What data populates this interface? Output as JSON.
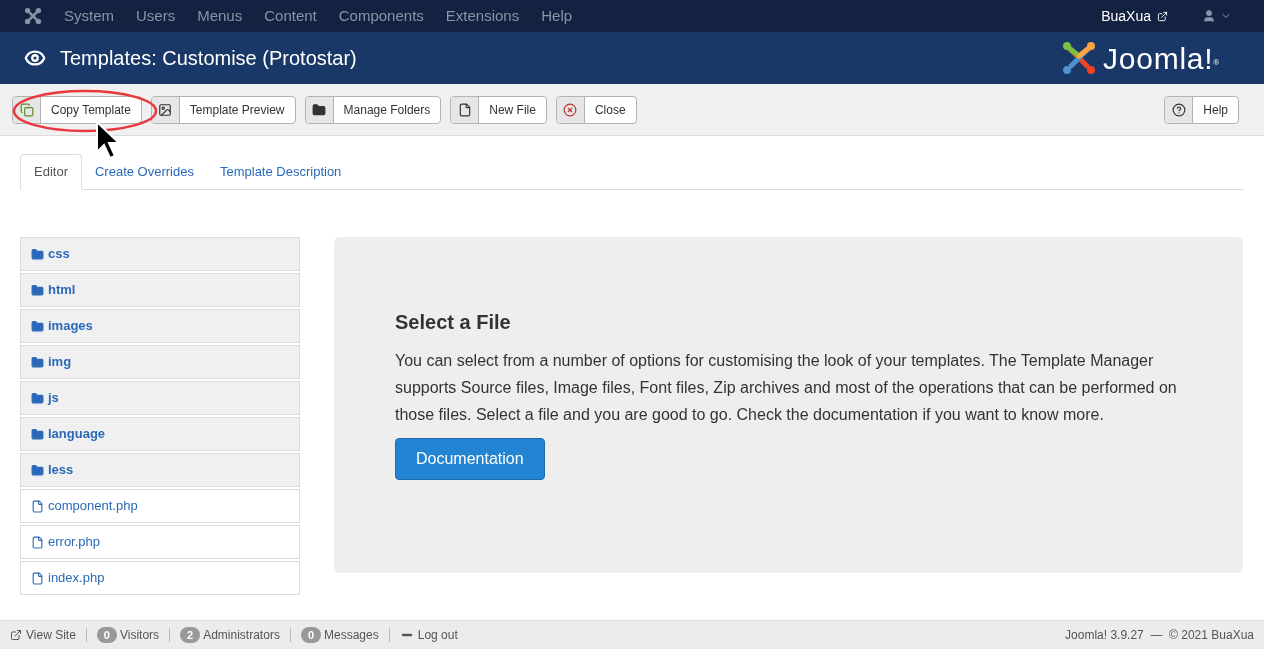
{
  "top_menu": {
    "items": [
      "System",
      "Users",
      "Menus",
      "Content",
      "Components",
      "Extensions",
      "Help"
    ],
    "site_link": "BuaXua"
  },
  "header": {
    "title": "Templates: Customise (Protostar)",
    "logo_text": "Joomla!",
    "logo_mark": "®"
  },
  "toolbar": {
    "buttons": [
      "Copy Template",
      "Template Preview",
      "Manage Folders",
      "New File",
      "Close"
    ],
    "help": "Help"
  },
  "tabs": [
    {
      "label": "Editor",
      "selected": true
    },
    {
      "label": "Create Overrides",
      "selected": false
    },
    {
      "label": "Template Description",
      "selected": false
    }
  ],
  "files": [
    {
      "name": "css",
      "kind": "folder"
    },
    {
      "name": "html",
      "kind": "folder"
    },
    {
      "name": "images",
      "kind": "folder"
    },
    {
      "name": "img",
      "kind": "folder"
    },
    {
      "name": "js",
      "kind": "folder"
    },
    {
      "name": "language",
      "kind": "folder"
    },
    {
      "name": "less",
      "kind": "folder"
    },
    {
      "name": "component.php",
      "kind": "file"
    },
    {
      "name": "error.php",
      "kind": "file"
    },
    {
      "name": "index.php",
      "kind": "file"
    }
  ],
  "panel": {
    "heading": "Select a File",
    "text": "You can select from a number of options for customising the look of your templates. The Template Manager supports Source files, Image files, Font files, Zip archives and most of the operations that can be performed on those files. Select a file and you are good to go. Check the documentation if you want to know more.",
    "button": "Documentation"
  },
  "status_bar": {
    "view_site": "View Site",
    "counters": [
      {
        "count": "0",
        "label": "Visitors"
      },
      {
        "count": "2",
        "label": "Administrators"
      },
      {
        "count": "0",
        "label": "Messages"
      }
    ],
    "logout": "Log out",
    "version": "Joomla! 3.9.27  —  © 2021 BuaXua"
  }
}
